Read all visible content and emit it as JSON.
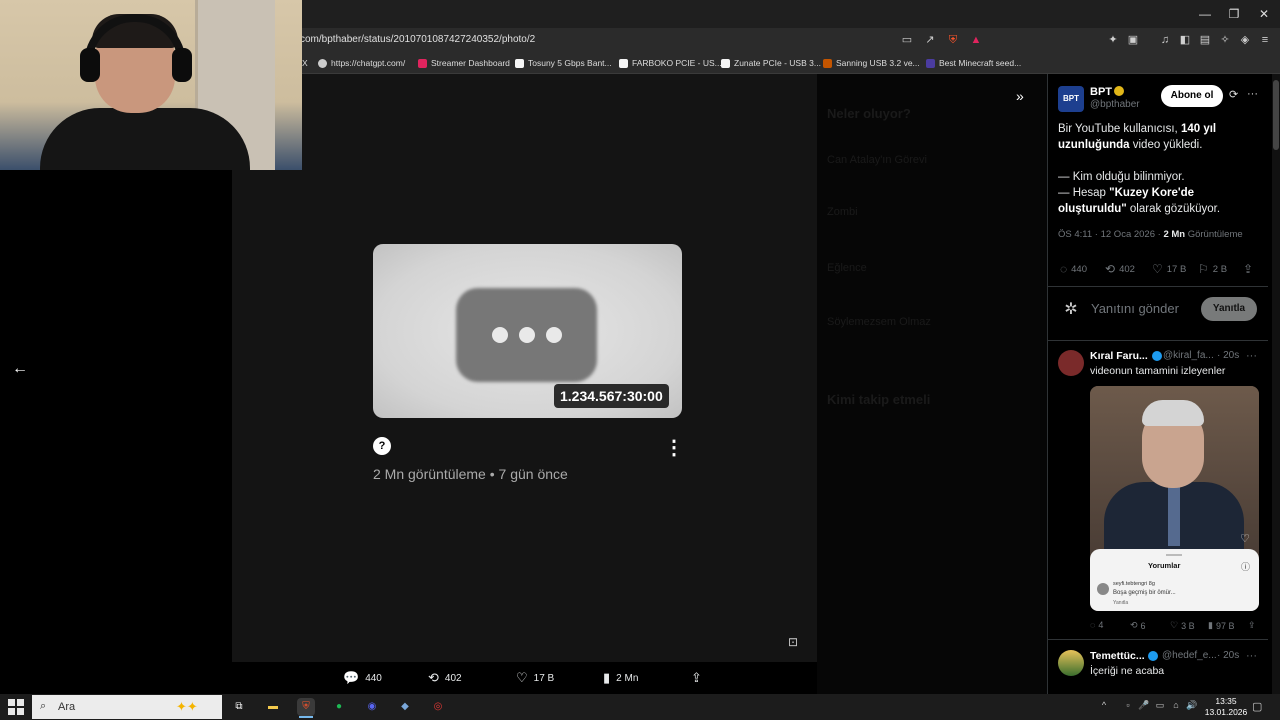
{
  "browser": {
    "url": "com/bpthaber/status/2010701087427240352/photo/2",
    "window_controls": [
      "—",
      "❐",
      "✕"
    ],
    "bookmarks": [
      {
        "label": "X",
        "color": "#000000"
      },
      {
        "label": "https://chatgpt.com/",
        "color": "#cccccc"
      },
      {
        "label": "Streamer Dashboard",
        "color": "#e0245e"
      },
      {
        "label": "Tosuny 5 Gbps Bant...",
        "color": "#f5f5f5"
      },
      {
        "label": "FARBOKO PCIE - US...",
        "color": "#f5f5f5"
      },
      {
        "label": "Zunate PCIe - USB 3...",
        "color": "#f5f5f5"
      },
      {
        "label": "Sanning USB 3.2 ve...",
        "color": "#c45500"
      },
      {
        "label": "Best Minecraft seed...",
        "color": "#4b3ca0"
      }
    ],
    "toolbar_icons": [
      "screen-icon",
      "share-icon",
      "brave-shield-icon",
      "brave-rewards-icon",
      "extensions-icon",
      "music-icon",
      "sidebar-icon",
      "wallet-icon",
      "leo-icon",
      "vpn-icon",
      "menu-icon"
    ]
  },
  "viewer": {
    "back_icon": "←",
    "expand_icon": "»",
    "yt_card": {
      "duration": "1.234.567:30:00",
      "question_mark": "?",
      "more_icon": "⋮",
      "meta": "2 Mn görüntüleme • 7 gün önce"
    },
    "actions": {
      "replies": "440",
      "reposts": "402",
      "likes": "17 B",
      "views": "2 Mn"
    }
  },
  "tweet": {
    "account_name": "BPT",
    "avatar_text": "BPT",
    "handle": "@bpthaber",
    "follow_label": "Abone ol",
    "text_line1_a": "Bir YouTube kullanıcısı, ",
    "text_line1_b": "140 yıl uzunluğunda",
    "text_line1_c": " video yükledi.",
    "text_line2": "— Kim olduğu bilinmiyor.",
    "text_line3_a": "— Hesap ",
    "text_line3_b": "\"Kuzey Kore'de oluşturuldu\"",
    "text_line3_c": " olarak gözüküyor.",
    "timestamp": "ÖS 4:11 · 12 Oca 2026 · ",
    "views_count": "2 Mn",
    "views_label": " Görüntüleme",
    "stats": {
      "replies": "440",
      "reposts": "402",
      "likes": "17 B",
      "bookmarks": "2 B"
    },
    "reply_placeholder": "Yanıtını gönder",
    "reply_button": "Yanıtla"
  },
  "replies": [
    {
      "name": "Kıral Faru...",
      "handle": "@kiral_fa...",
      "time": "· 20s",
      "text": "videonun tamamini izleyenler",
      "media": {
        "sheet_title": "Yorumlar",
        "sheet_user": "seyfi.tebtengri 8g",
        "sheet_body": "Boşa geçmiş bir ömür...",
        "sheet_reply": "Yanıtla"
      },
      "stats": {
        "replies": "4",
        "reposts": "6",
        "likes": "3 B",
        "views": "97 B"
      }
    },
    {
      "name": "Temettüc...",
      "handle": "@hedef_e...",
      "time": "· 20s",
      "text": "İçeriği ne acaba"
    }
  ],
  "taskbar": {
    "search_placeholder": "Ara",
    "time": "13:35",
    "date": "13.01.2026"
  }
}
